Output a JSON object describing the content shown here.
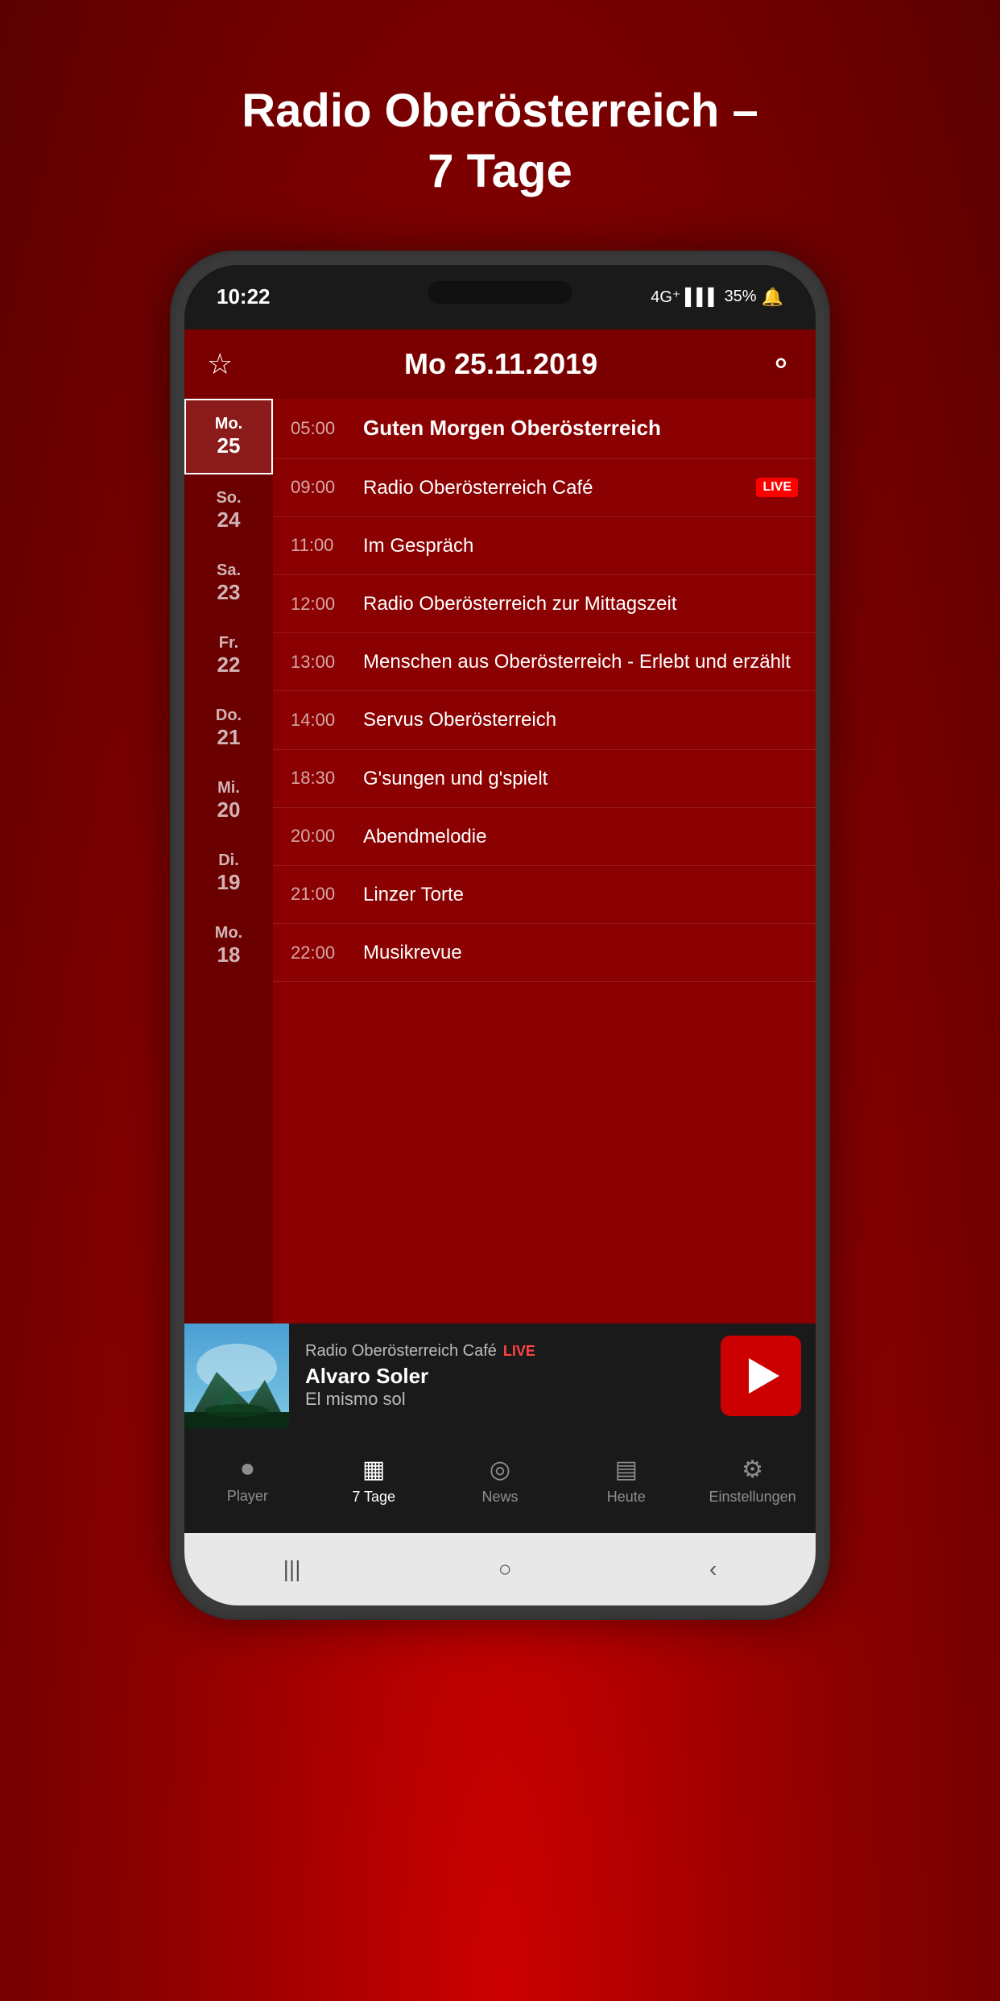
{
  "page": {
    "title_line1": "Radio Oberösterreich –",
    "title_line2": "7 Tage"
  },
  "status_bar": {
    "time": "10:22",
    "network": "4G+",
    "battery": "35%"
  },
  "header": {
    "star_label": "☆",
    "date": "Mo 25.11.2019",
    "search_label": "🔍"
  },
  "days": [
    {
      "name": "Mo.",
      "num": "25",
      "active": true
    },
    {
      "name": "So.",
      "num": "24",
      "active": false
    },
    {
      "name": "Sa.",
      "num": "23",
      "active": false
    },
    {
      "name": "Fr.",
      "num": "22",
      "active": false
    },
    {
      "name": "Do.",
      "num": "21",
      "active": false
    },
    {
      "name": "Mi.",
      "num": "20",
      "active": false
    },
    {
      "name": "Di.",
      "num": "19",
      "active": false
    },
    {
      "name": "Mo.",
      "num": "18",
      "active": false
    }
  ],
  "schedule": [
    {
      "time": "05:00",
      "title": "Guten Morgen Oberösterreich",
      "live": false,
      "first": true
    },
    {
      "time": "09:00",
      "title": "Radio Oberösterreich Café",
      "live": true,
      "first": false
    },
    {
      "time": "11:00",
      "title": "Im Gespräch",
      "live": false,
      "first": false
    },
    {
      "time": "12:00",
      "title": "Radio Oberösterreich zur Mittagszeit",
      "live": false,
      "first": false
    },
    {
      "time": "13:00",
      "title": "Menschen aus Oberösterreich - Erlebt und erzählt",
      "live": false,
      "first": false
    },
    {
      "time": "14:00",
      "title": "Servus Oberösterreich",
      "live": false,
      "first": false
    },
    {
      "time": "18:30",
      "title": "G'sungen und g'spielt",
      "live": false,
      "first": false
    },
    {
      "time": "20:00",
      "title": "Abendmelodie",
      "live": false,
      "first": false
    },
    {
      "time": "21:00",
      "title": "Linzer Torte",
      "live": false,
      "first": false
    },
    {
      "time": "22:00",
      "title": "Musikrevue",
      "live": false,
      "first": false
    }
  ],
  "now_playing": {
    "station": "Radio Oberösterreich Café",
    "live_label": "LIVE",
    "artist": "Alvaro Soler",
    "song": "El mismo sol",
    "play_label": "▶"
  },
  "bottom_nav": {
    "items": [
      {
        "id": "player",
        "label": "Player",
        "active": false
      },
      {
        "id": "7tage",
        "label": "7 Tage",
        "active": true
      },
      {
        "id": "news",
        "label": "News",
        "active": false
      },
      {
        "id": "heute",
        "label": "Heute",
        "active": false
      },
      {
        "id": "einstellungen",
        "label": "Einstellungen",
        "active": false
      }
    ]
  }
}
